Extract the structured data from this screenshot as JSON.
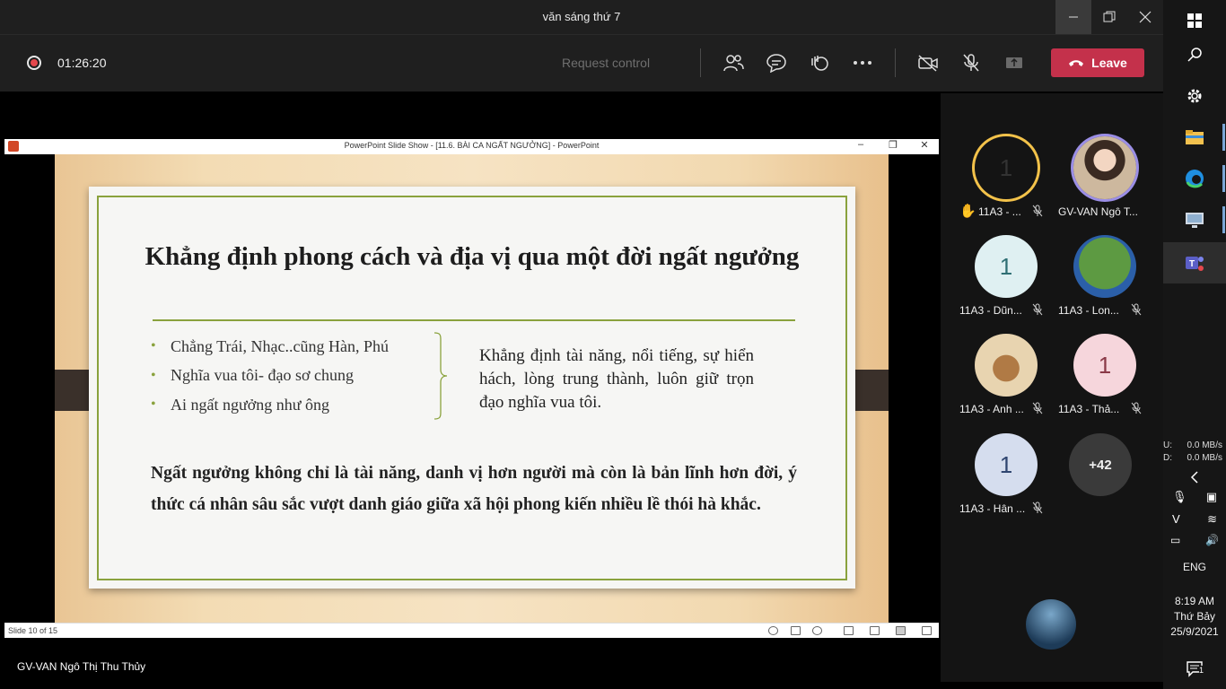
{
  "window": {
    "title": "văn sáng thứ 7"
  },
  "toolbar": {
    "timer": "01:26:20",
    "request_control": "Request control",
    "leave_label": "Leave"
  },
  "ppt": {
    "window_title": "PowerPoint Slide Show - [11.6. BÀI CA NGẤT NGƯỞNG] - PowerPoint",
    "slide_number": "Slide 10 of 15"
  },
  "slide": {
    "title": "Khẳng định phong cách và địa vị qua một đời ngất ngưởng",
    "bullets": [
      "Chẳng Trái, Nhạc..cũng Hàn, Phú",
      "Nghĩa vua tôi- đạo sơ chung",
      "Ai ngất ngưởng như ông"
    ],
    "aside": "Khẳng định tài năng, nổi tiếng, sự hiển hách, lòng trung thành, luôn giữ trọn đạo nghĩa vua tôi.",
    "paragraph": "Ngất ngưởng không chỉ là tài năng, danh vị hơn người mà còn là bản lĩnh hơn đời, ý thức cá nhân sâu sắc vượt danh giáo giữa xã hội phong kiến nhiều lề thói hà khắc."
  },
  "presenter": "GV-VAN Ngô Thị Thu Thủy",
  "participants": [
    {
      "initial": "1",
      "name": "11A3 - ...",
      "bg": "#f0d4d8",
      "hand": true
    },
    {
      "initial": "",
      "name": "GV-VAN Ngô T...",
      "bg": "#c9b8a6"
    },
    {
      "initial": "1",
      "name": "11A3 - Dũn...",
      "bg": "#dff0f2"
    },
    {
      "initial": "",
      "name": "11A3 - Lon...",
      "bg": "#4f8a3a"
    },
    {
      "initial": "",
      "name": "11A3 - Anh ...",
      "bg": "#d9b88a"
    },
    {
      "initial": "1",
      "name": "11A3 - Thả...",
      "bg": "#f6d6dc"
    },
    {
      "initial": "1",
      "name": "11A3 - Hân ...",
      "bg": "#d5ddee"
    }
  ],
  "more_count": "+42",
  "tray": {
    "upload_label": "U:",
    "upload_value": "0.0 MB/s",
    "download_label": "D:",
    "download_value": "0.0 MB/s",
    "lang": "ENG",
    "time": "8:19 AM",
    "day": "Thứ Bảy",
    "date": "25/9/2021",
    "notif_count": "1"
  },
  "colors": {
    "leave": "#c4314b",
    "accent_green": "#8aa23d",
    "hand_ring": "#f3c24a"
  }
}
